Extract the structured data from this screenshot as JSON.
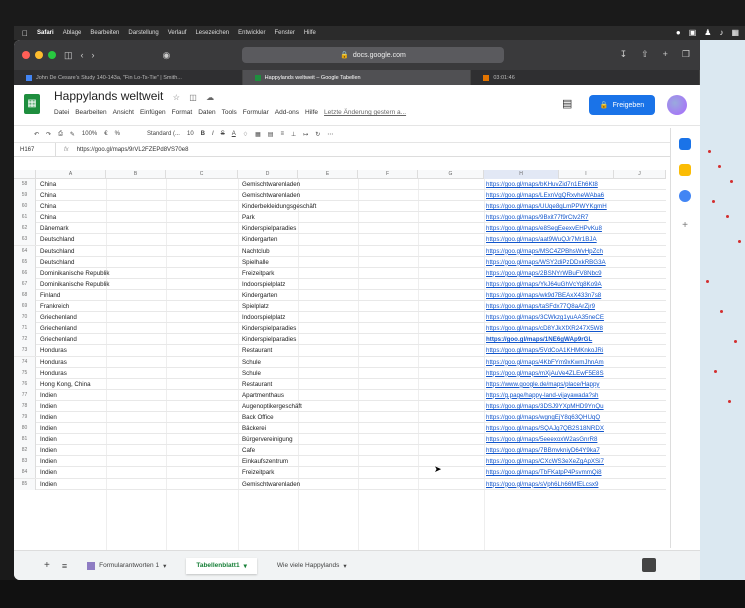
{
  "menubar": {
    "app": "Safari",
    "items": [
      "Ablage",
      "Bearbeiten",
      "Darstellung",
      "Verlauf",
      "Lesezeichen",
      "Entwickler",
      "Fenster",
      "Hilfe"
    ]
  },
  "browser": {
    "url": "docs.google.com",
    "tabs": [
      {
        "label": "John De Cesare's Study 140-143a, \"Fin Lo-Ts-Tie\" | Smith..."
      },
      {
        "label": "Happylands weltweit – Google Tabellen"
      },
      {
        "label": "03:01:46"
      }
    ]
  },
  "sheets": {
    "title": "Happylands weltweit",
    "menu": [
      "Datei",
      "Bearbeiten",
      "Ansicht",
      "Einfügen",
      "Format",
      "Daten",
      "Tools",
      "Formular",
      "Add-ons",
      "Hilfe"
    ],
    "last_edit": "Letzte Änderung gestern a...",
    "share_label": "Freigeben",
    "zoom": "100%",
    "font": "Standard (...",
    "font_size": "10",
    "cell_ref": "H167",
    "formula": "https://goo.gl/maps/9rVL2FZEPd8VS70e8"
  },
  "columns": [
    "A",
    "B",
    "C",
    "D",
    "E",
    "F",
    "G",
    "H",
    "I",
    "J"
  ],
  "rows": [
    {
      "n": "58",
      "country": "China",
      "type": "Gemischtwarenladen",
      "link": "https://goo.gl/maps/bKHuvZid7n1Eh6Kt8"
    },
    {
      "n": "59",
      "country": "China",
      "type": "Gemischtwarenladen",
      "link": "https://goo.gl/maps/LExnVgQRxvheWAba6"
    },
    {
      "n": "60",
      "country": "China",
      "type": "Kinderbekleidungsgeschäft",
      "link": "https://goo.gl/maps/UUqe8gLmPPWYKgmH"
    },
    {
      "n": "61",
      "country": "China",
      "type": "Park",
      "link": "https://goo.gl/maps/9Bxit77f9rCtv2R7"
    },
    {
      "n": "62",
      "country": "Dänemark",
      "type": "Kinderspielparadies",
      "link": "https://goo.gl/maps/e8SegEeexvEHPvKu8"
    },
    {
      "n": "63",
      "country": "Deutschland",
      "type": "Kindergarten",
      "link": "https://goo.gl/maps/aat9WuQJr7Mr1BJA"
    },
    {
      "n": "64",
      "country": "Deutschland",
      "type": "Nachtclub",
      "link": "https://goo.gl/maps/MSC4ZPBhsWvHpZch"
    },
    {
      "n": "65",
      "country": "Deutschland",
      "type": "Spielhalle",
      "link": "https://goo.gl/maps/WSY2diPzDDxkRBG3A"
    },
    {
      "n": "66",
      "country": "Dominikanische Republik",
      "type": "Freizeitpark",
      "link": "https://goo.gl/maps/2BSNYrWBuFV8Nbc9"
    },
    {
      "n": "67",
      "country": "Dominikanische Republik",
      "type": "Indoorspielplatz",
      "link": "https://goo.gl/maps/YkJ64uGhVcYq8Ko9A"
    },
    {
      "n": "68",
      "country": "Finland",
      "type": "Kindergarten",
      "link": "https://goo.gl/maps/wk9d7BEAxX433n7s8"
    },
    {
      "n": "69",
      "country": "Frankreich",
      "type": "Spielplatz",
      "link": "https://goo.gl/maps/taSFdx77Q8aArZjr9"
    },
    {
      "n": "70",
      "country": "Griechenland",
      "type": "Indoorspielplatz",
      "link": "https://goo.gl/maps/3CWkzg1yuAA35neCE"
    },
    {
      "n": "71",
      "country": "Griechenland",
      "type": "Kinderspielparadies",
      "link": "https://goo.gl/maps/cD8YJkXfXR247X5W8"
    },
    {
      "n": "72",
      "country": "Griechenland",
      "type": "Kinderspielparadies",
      "link": "https://goo.gl/maps/1NE6gWAp9rGL",
      "bold": true
    },
    {
      "n": "73",
      "country": "Honduras",
      "type": "Restaurant",
      "link": "https://goo.gl/maps/5VdCoA1KHMKnkoJRi"
    },
    {
      "n": "74",
      "country": "Honduras",
      "type": "Schule",
      "link": "https://goo.gl/maps/4KbFYm9xKwmJhnAm"
    },
    {
      "n": "75",
      "country": "Honduras",
      "type": "Schule",
      "link": "https://goo.gl/maps/mXjAuVe4ZLEwF5E8S"
    },
    {
      "n": "76",
      "country": "Hong Kong, China",
      "type": "Restaurant",
      "link": "https://www.google.de/maps/place/Happy"
    },
    {
      "n": "77",
      "country": "Indien",
      "type": "Apartmenthaus",
      "link": "https://g.page/happy-land-vijayawada?sh"
    },
    {
      "n": "78",
      "country": "Indien",
      "type": "Augenoptikergeschäft",
      "link": "https://goo.gl/maps/3DSJ9YXpMHD9YnQu"
    },
    {
      "n": "79",
      "country": "Indien",
      "type": "Back Office",
      "link": "https://goo.gl/maps/wgngEjY8q63QHUqQ"
    },
    {
      "n": "80",
      "country": "Indien",
      "type": "Bäckerei",
      "link": "https://goo.gl/maps/SQAJg7QB2S18NRDX"
    },
    {
      "n": "81",
      "country": "Indien",
      "type": "Bürgervereinigung",
      "link": "https://goo.gl/maps/5eeexoxW2asGnrR8"
    },
    {
      "n": "82",
      "country": "Indien",
      "type": "Cafe",
      "link": "https://goo.gl/maps/7BBmvkniyD64Y9ka7"
    },
    {
      "n": "83",
      "country": "Indien",
      "type": "Einkaufszentrum",
      "link": "https://goo.gl/maps/CXcWS3eXeZgApXSi7"
    },
    {
      "n": "84",
      "country": "Indien",
      "type": "Freizeitpark",
      "link": "https://goo.gl/maps/TbFKatpP4PsvmmQi8"
    },
    {
      "n": "85",
      "country": "Indien",
      "type": "Gemischtwarenladen",
      "link": "https://goo.gl/maps/sVph6Lh66MfELcsx9"
    }
  ],
  "sheet_tabs": [
    {
      "label": "Formularantworten 1"
    },
    {
      "label": "Tabellenblatt1"
    },
    {
      "label": "Wie viele Happylands"
    }
  ],
  "colors": {
    "accent": "#1a73e8",
    "brand_green": "#1e8e3e",
    "link": "#1155cc"
  }
}
